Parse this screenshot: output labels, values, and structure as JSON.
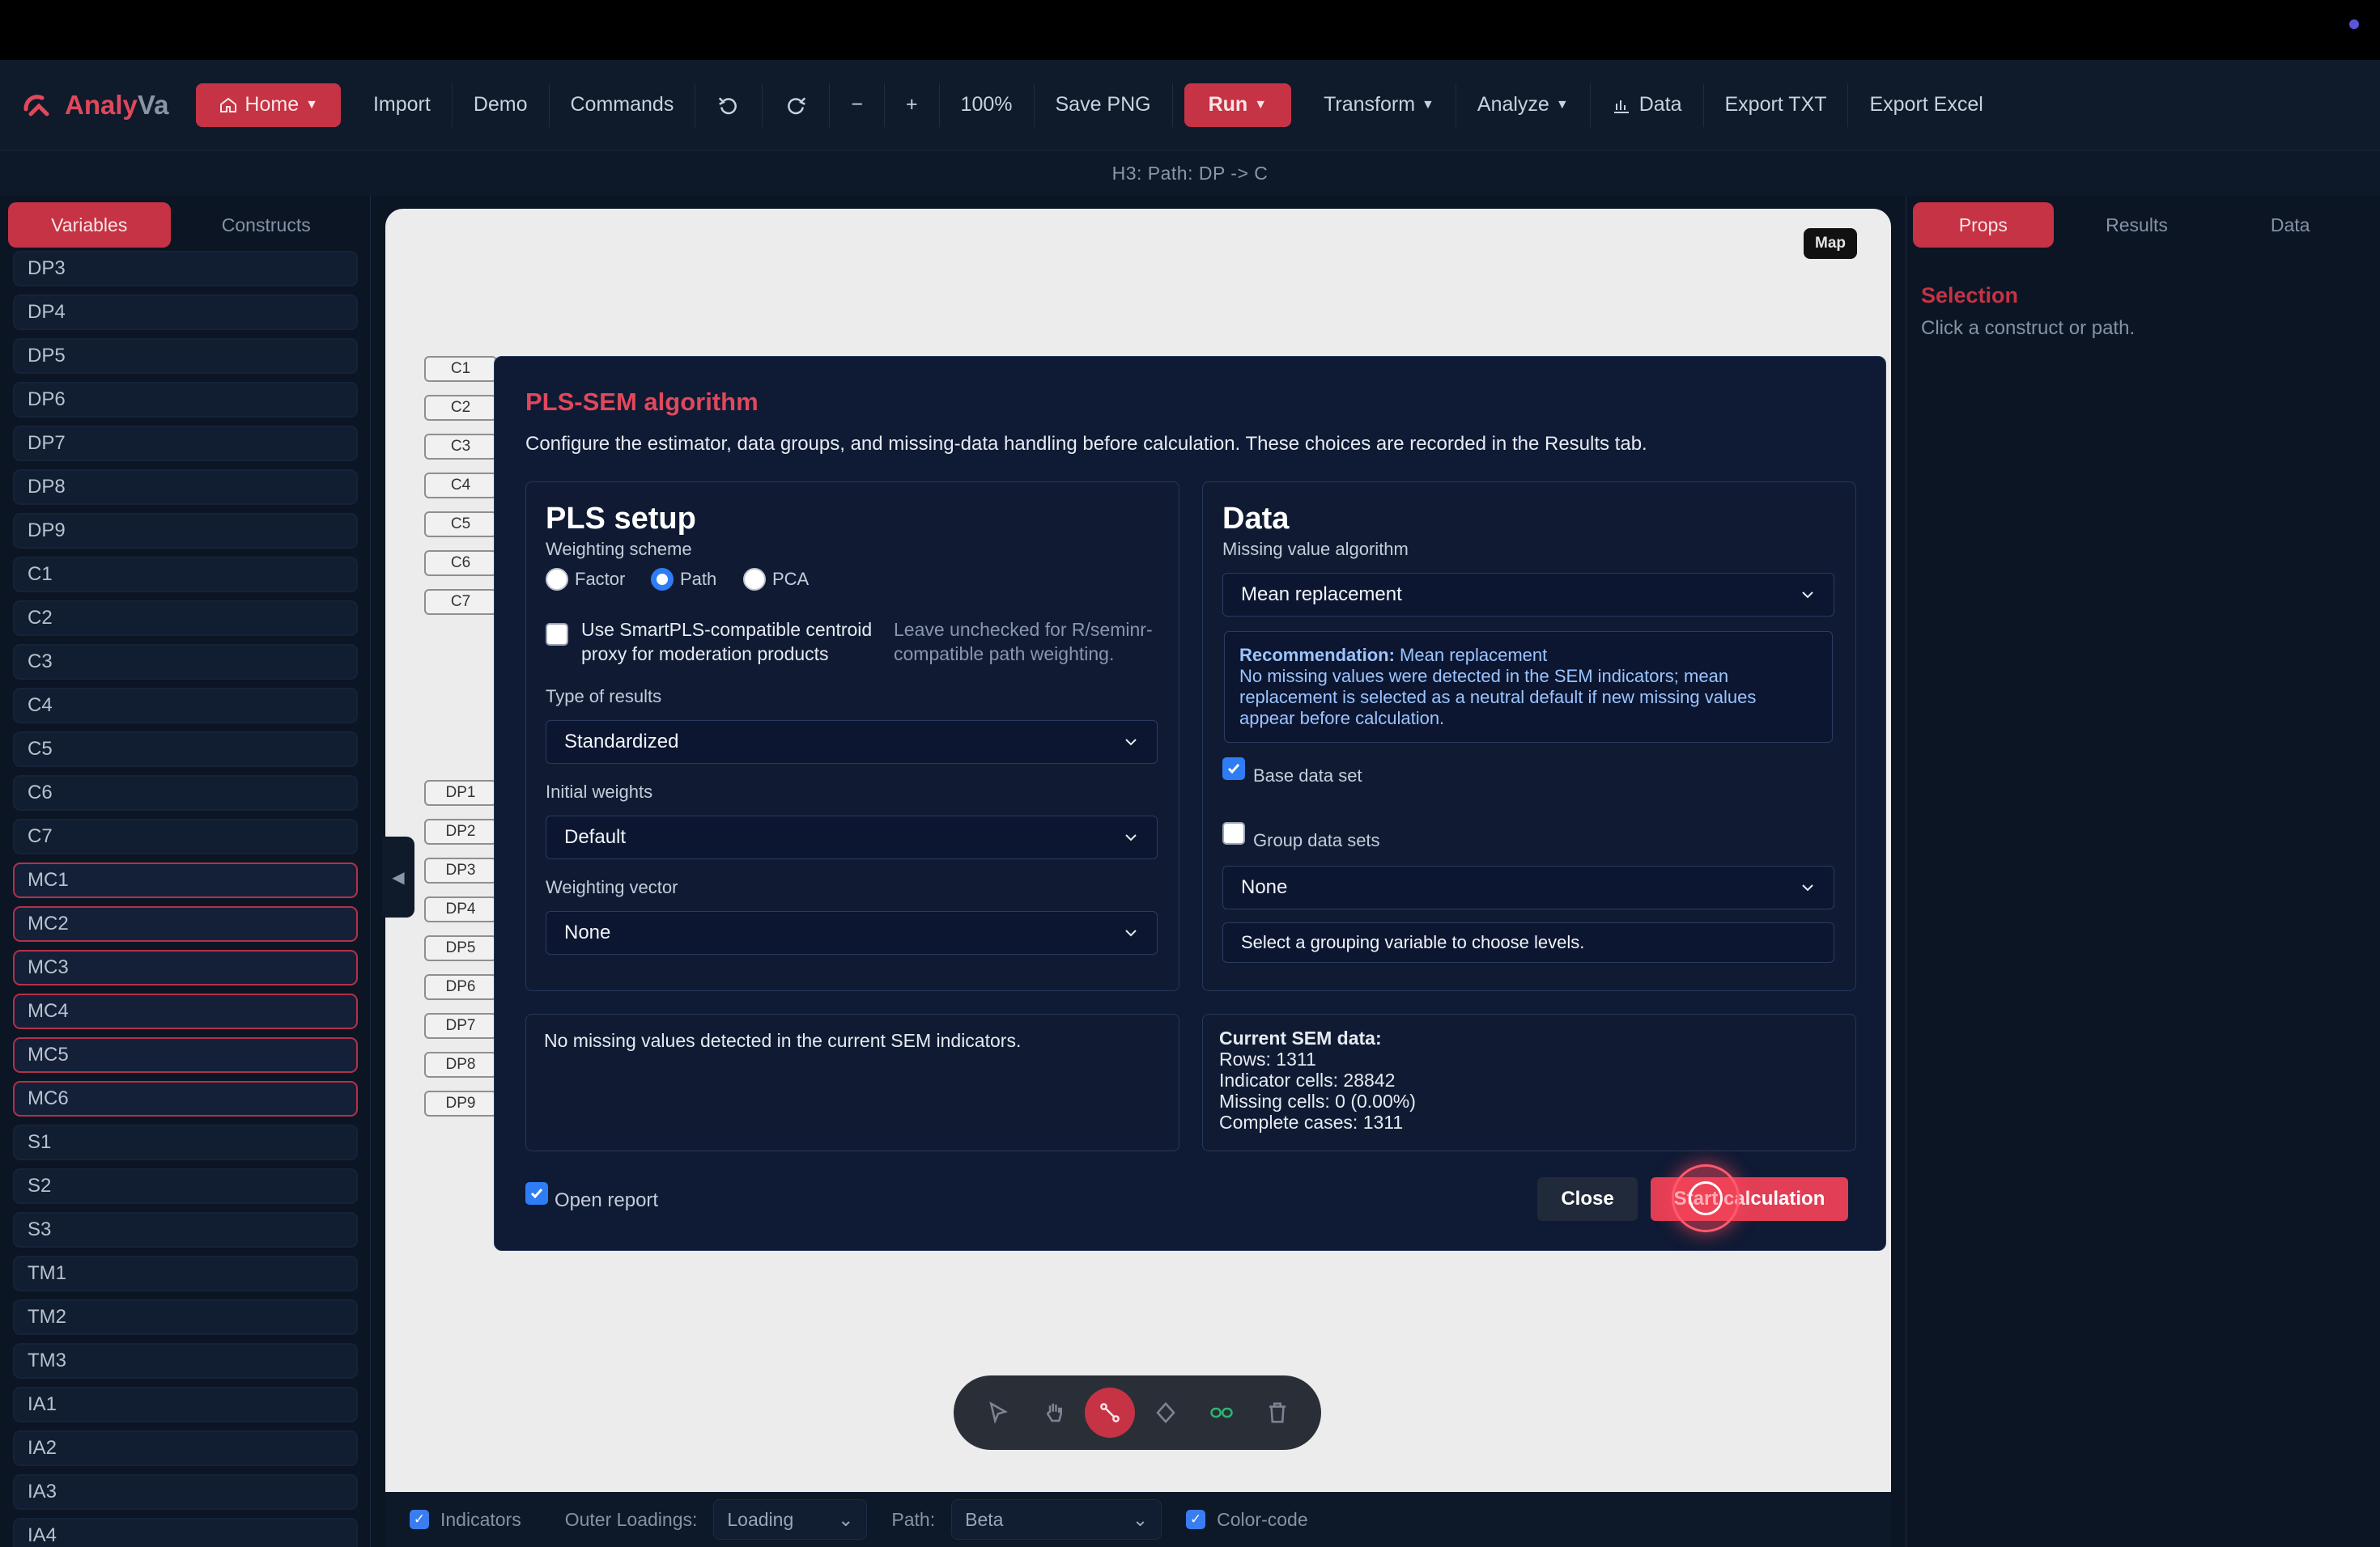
{
  "app": {
    "logo_part1": "Analy",
    "logo_part2": "Va"
  },
  "toolbar": {
    "home": "Home",
    "import": "Import",
    "demo": "Demo",
    "commands": "Commands",
    "zoom_out": "−",
    "zoom_in": "+",
    "zoom": "100%",
    "save_png": "Save PNG",
    "run": "Run",
    "transform": "Transform",
    "analyze": "Analyze",
    "data": "Data",
    "export_txt": "Export TXT",
    "export_excel": "Export Excel"
  },
  "banner": "H3: Path: DP -> C",
  "left": {
    "tabs": [
      "Variables",
      "Constructs"
    ],
    "variables": [
      "DP3",
      "DP4",
      "DP5",
      "DP6",
      "DP7",
      "DP8",
      "DP9",
      "C1",
      "C2",
      "C3",
      "C4",
      "C5",
      "C6",
      "C7",
      "MC1",
      "MC2",
      "MC3",
      "MC4",
      "MC5",
      "MC6",
      "S1",
      "S2",
      "S3",
      "TM1",
      "TM2",
      "TM3",
      "IA1",
      "IA2",
      "IA3",
      "IA4"
    ]
  },
  "canvas": {
    "map": "Map",
    "indicators": [
      "C1",
      "C2",
      "C3",
      "C4",
      "C5",
      "C6",
      "C7",
      "DP1",
      "DP2",
      "DP3",
      "DP4",
      "DP5",
      "DP6",
      "DP7",
      "DP8",
      "DP9"
    ]
  },
  "bottom": {
    "indicators": "Indicators",
    "outer_loadings_label": "Outer Loadings:",
    "outer_loadings_value": "Loading",
    "path_label": "Path:",
    "path_value": "Beta",
    "color_code": "Color-code"
  },
  "right": {
    "tabs": [
      "Props",
      "Results",
      "Data"
    ],
    "selection_title": "Selection",
    "selection_sub": "Click a construct or path."
  },
  "modal": {
    "title": "PLS-SEM algorithm",
    "description": "Configure the estimator, data groups, and missing-data handling before calculation. These choices are recorded in the Results tab.",
    "pls": {
      "title": "PLS setup",
      "weighting_label": "Weighting scheme",
      "options": [
        "Factor",
        "Path",
        "PCA"
      ],
      "centroid_label_1": "Use SmartPLS-compatible centroid",
      "centroid_label_2": "proxy for moderation products",
      "centroid_hint_1": "Leave unchecked for R/seminr-",
      "centroid_hint_2": "compatible path weighting.",
      "type_label": "Type of results",
      "type_value": "Standardized",
      "initial_label": "Initial weights",
      "initial_value": "Default",
      "vector_label": "Weighting vector",
      "vector_value": "None"
    },
    "data": {
      "title": "Data",
      "missing_label": "Missing value algorithm",
      "missing_value": "Mean replacement",
      "rec_title": "Recommendation:",
      "rec_value": "Mean replacement",
      "rec_line1": "No missing values were detected in the SEM indicators; mean",
      "rec_line2": "replacement is selected as a neutral default if new missing values",
      "rec_line3": "appear before calculation.",
      "base_label": "Base data set",
      "group_label": "Group data sets",
      "group_value": "None",
      "group_hint": "Select a grouping variable to choose levels."
    },
    "missing_note": "No missing values detected in the current SEM indicators.",
    "summary": {
      "title": "Current SEM data:",
      "rows": "Rows: 1311",
      "cells": "Indicator cells: 28842",
      "missing": "Missing cells: 0 (0.00%)",
      "complete": "Complete cases: 1311"
    },
    "open_report": "Open report",
    "close": "Close",
    "start": "Start calculation"
  }
}
